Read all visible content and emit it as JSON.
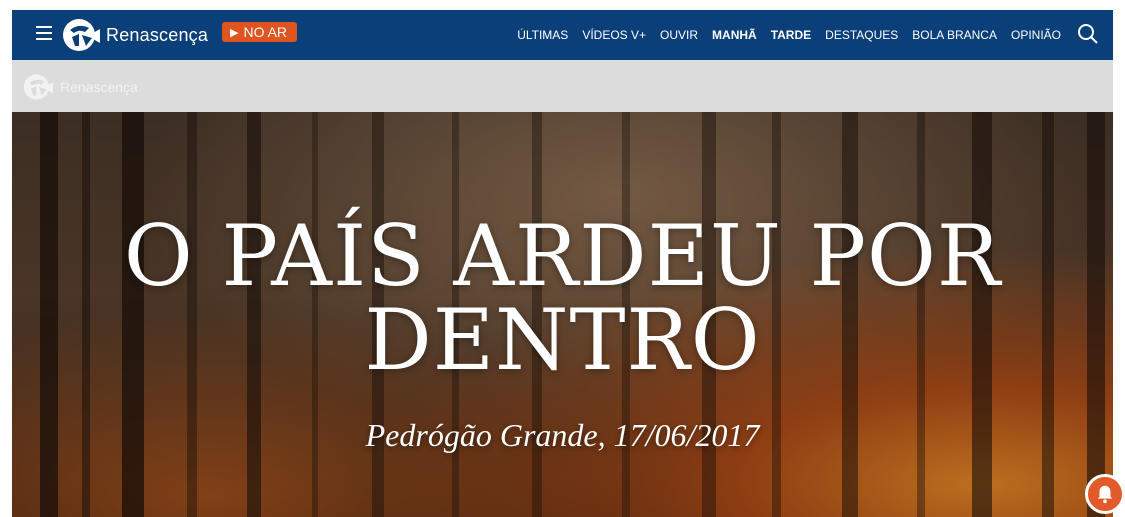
{
  "header": {
    "brand": "Renascença",
    "live_label": "NO AR",
    "nav": [
      {
        "label": "ÚLTIMAS",
        "bold": false
      },
      {
        "label": "VÍDEOS V+",
        "bold": false
      },
      {
        "label": "OUVIR",
        "bold": false
      },
      {
        "label": "MANHÃ",
        "bold": true
      },
      {
        "label": "TARDE",
        "bold": true
      },
      {
        "label": "DESTAQUES",
        "bold": false
      },
      {
        "label": "BOLA BRANCA",
        "bold": false
      },
      {
        "label": "OPINIÃO",
        "bold": false
      }
    ],
    "icons": {
      "menu": "hamburger-icon",
      "search": "search-icon"
    },
    "colors": {
      "bar": "#0a3f7a",
      "live": "#e0541f"
    }
  },
  "subheader": {
    "brand": "Renascença"
  },
  "hero": {
    "title_line1": "O PAÍS ARDEU POR",
    "title_line2": "DENTRO",
    "subtitle": "Pedrógão Grande, 17/06/2017"
  },
  "notification": {
    "icon": "bell-icon",
    "color": "#e35a2a"
  }
}
